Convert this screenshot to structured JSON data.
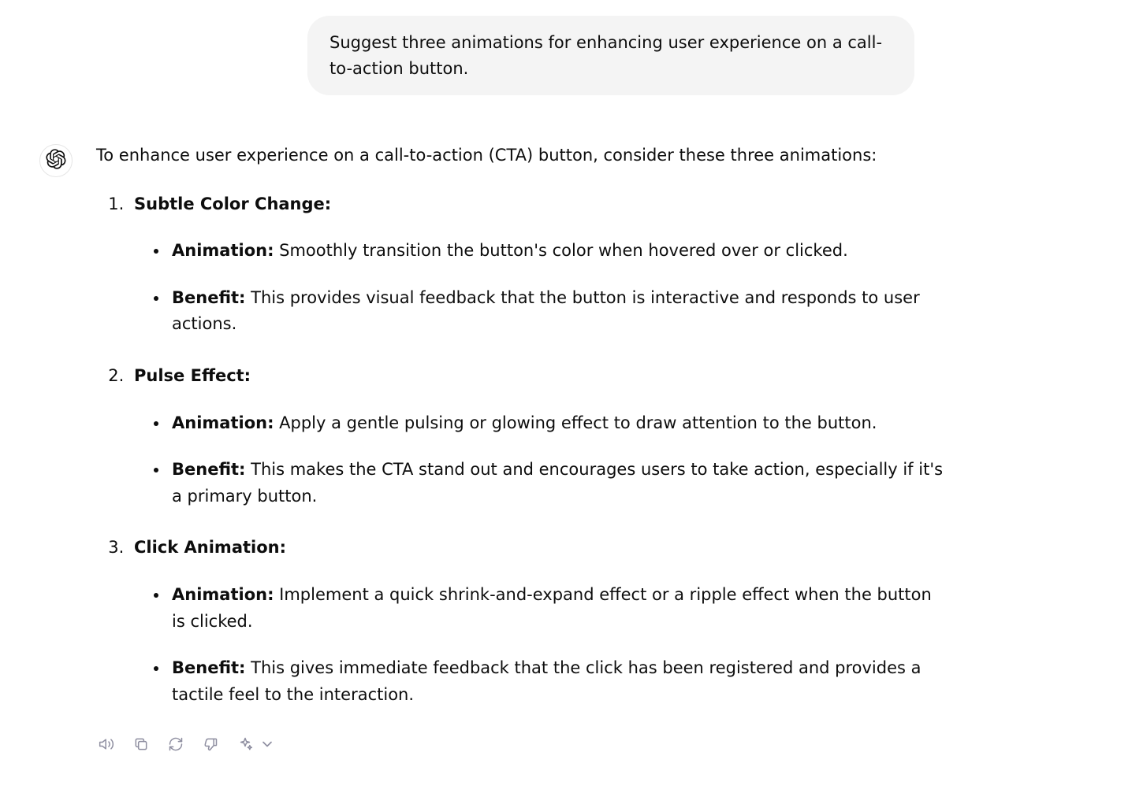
{
  "user_message": "Suggest three animations for enhancing user experience on a call-to-action button.",
  "intro": "To enhance user experience on a call-to-action (CTA) button, consider these three animations:",
  "items": [
    {
      "title": "Subtle Color Change:",
      "animation_label": "Animation:",
      "animation_text": " Smoothly transition the button's color when hovered over or clicked.",
      "benefit_label": "Benefit:",
      "benefit_text": " This provides visual feedback that the button is interactive and responds to user actions."
    },
    {
      "title": "Pulse Effect:",
      "animation_label": "Animation:",
      "animation_text": " Apply a gentle pulsing or glowing effect to draw attention to the button.",
      "benefit_label": "Benefit:",
      "benefit_text": " This makes the CTA stand out and encourages users to take action, especially if it's a primary button."
    },
    {
      "title": "Click Animation:",
      "animation_label": "Animation:",
      "animation_text": " Implement a quick shrink-and-expand effect or a ripple effect when the button is clicked.",
      "benefit_label": "Benefit:",
      "benefit_text": " This gives immediate feedback that the click has been registered and provides a tactile feel to the interaction."
    }
  ]
}
